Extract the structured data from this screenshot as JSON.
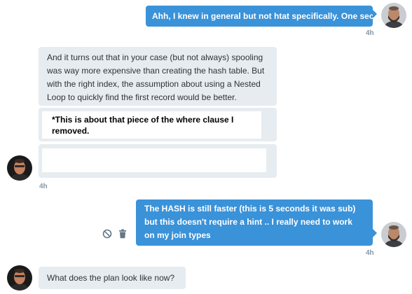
{
  "messages": [
    {
      "text": "Ahh, I knew in general but not htat specifically.  One sec",
      "time": "4h"
    },
    {
      "text": "And it turns out that in your case (but not always) spooling was way more expensive than creating the hash table. But with the right index, the assumption about using a Nested Loop to quickly find the first record would be better."
    },
    {
      "text": "*This is about that piece of the where clause I removed."
    },
    {
      "text": "",
      "time": "4h"
    },
    {
      "text": "The HASH is still faster (this is 5 seconds it was sub) but this doesn't require a hint .. I really need to work on my join types",
      "time": "4h"
    },
    {
      "text": "What does the plan look like now?"
    }
  ],
  "icons": {
    "mute": "block-icon",
    "delete": "trash-icon"
  },
  "colors": {
    "outgoing_bubble": "#3a92d9",
    "incoming_bubble": "#e6ecf0",
    "timestamp": "#8899a6"
  }
}
